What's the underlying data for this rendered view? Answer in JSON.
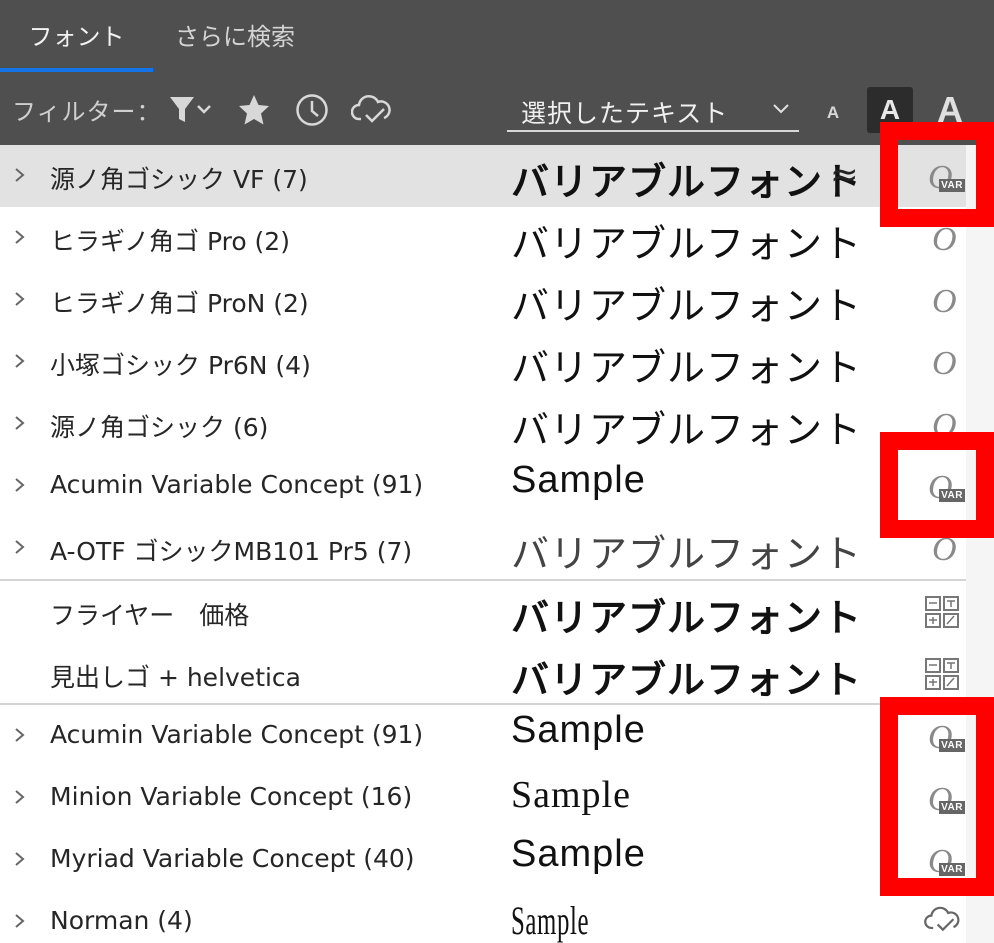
{
  "tabs": [
    {
      "label": "フォント",
      "active": true
    },
    {
      "label": "さらに検索",
      "active": false
    }
  ],
  "filterbar": {
    "label": "フィルター：",
    "icons": [
      "filter-icon",
      "star-icon",
      "clock-icon",
      "cloud-check-icon"
    ],
    "sample_text_select": "選択したテキスト",
    "size_buttons": {
      "small": "A",
      "medium": "A",
      "large": "A"
    }
  },
  "fonts": [
    {
      "name": "源ノ角ゴシック VF (7)",
      "sample": "バリアブルフォント",
      "type_icon": "variable-font-icon",
      "selected": true,
      "expandable": true
    },
    {
      "name": "ヒラギノ角ゴ Pro (2)",
      "sample": "バリアブルフォント",
      "type_icon": "opentype-icon",
      "expandable": true
    },
    {
      "name": "ヒラギノ角ゴ ProN (2)",
      "sample": "バリアブルフォント",
      "type_icon": "opentype-icon",
      "expandable": true
    },
    {
      "name": "小塚ゴシック Pr6N (4)",
      "sample": "バリアブルフォント",
      "type_icon": "opentype-icon",
      "expandable": true
    },
    {
      "name": "源ノ角ゴシック (6)",
      "sample": "バリアブルフォント",
      "type_icon": "opentype-icon",
      "expandable": true
    },
    {
      "name": "Acumin Variable Concept (91)",
      "sample": "Sample",
      "type_icon": "variable-font-icon",
      "expandable": true
    },
    {
      "name": "A-OTF ゴシックMB101 Pr5 (7)",
      "sample": "バリアブルフォント",
      "type_icon": "opentype-icon",
      "expandable": true
    }
  ],
  "composite_fonts": [
    {
      "name": "フライヤー　価格",
      "sample": "バリアブルフォント",
      "type_icon": "composite-font-icon"
    },
    {
      "name": "見出しゴ + helvetica",
      "sample": "バリアブルフォント",
      "type_icon": "composite-font-icon"
    }
  ],
  "more_fonts": [
    {
      "name": "Acumin Variable Concept (91)",
      "sample": "Sample",
      "type_icon": "variable-font-icon"
    },
    {
      "name": "Minion Variable Concept (16)",
      "sample": "Sample",
      "type_icon": "variable-font-icon"
    },
    {
      "name": "Myriad Variable Concept (40)",
      "sample": "Sample",
      "type_icon": "variable-font-icon"
    },
    {
      "name": "Norman (4)",
      "sample": "Sample",
      "type_icon": "cloud-check-icon"
    }
  ],
  "misc": {
    "approx_glyph": "≈",
    "var_badge": "VAR",
    "opentype_glyph": "O"
  },
  "colors": {
    "header_bg": "#4f4f4f",
    "active_tab_underline": "#1473e6",
    "selected_row_bg": "#e2e2e2",
    "highlight_box": "#ff0000"
  }
}
